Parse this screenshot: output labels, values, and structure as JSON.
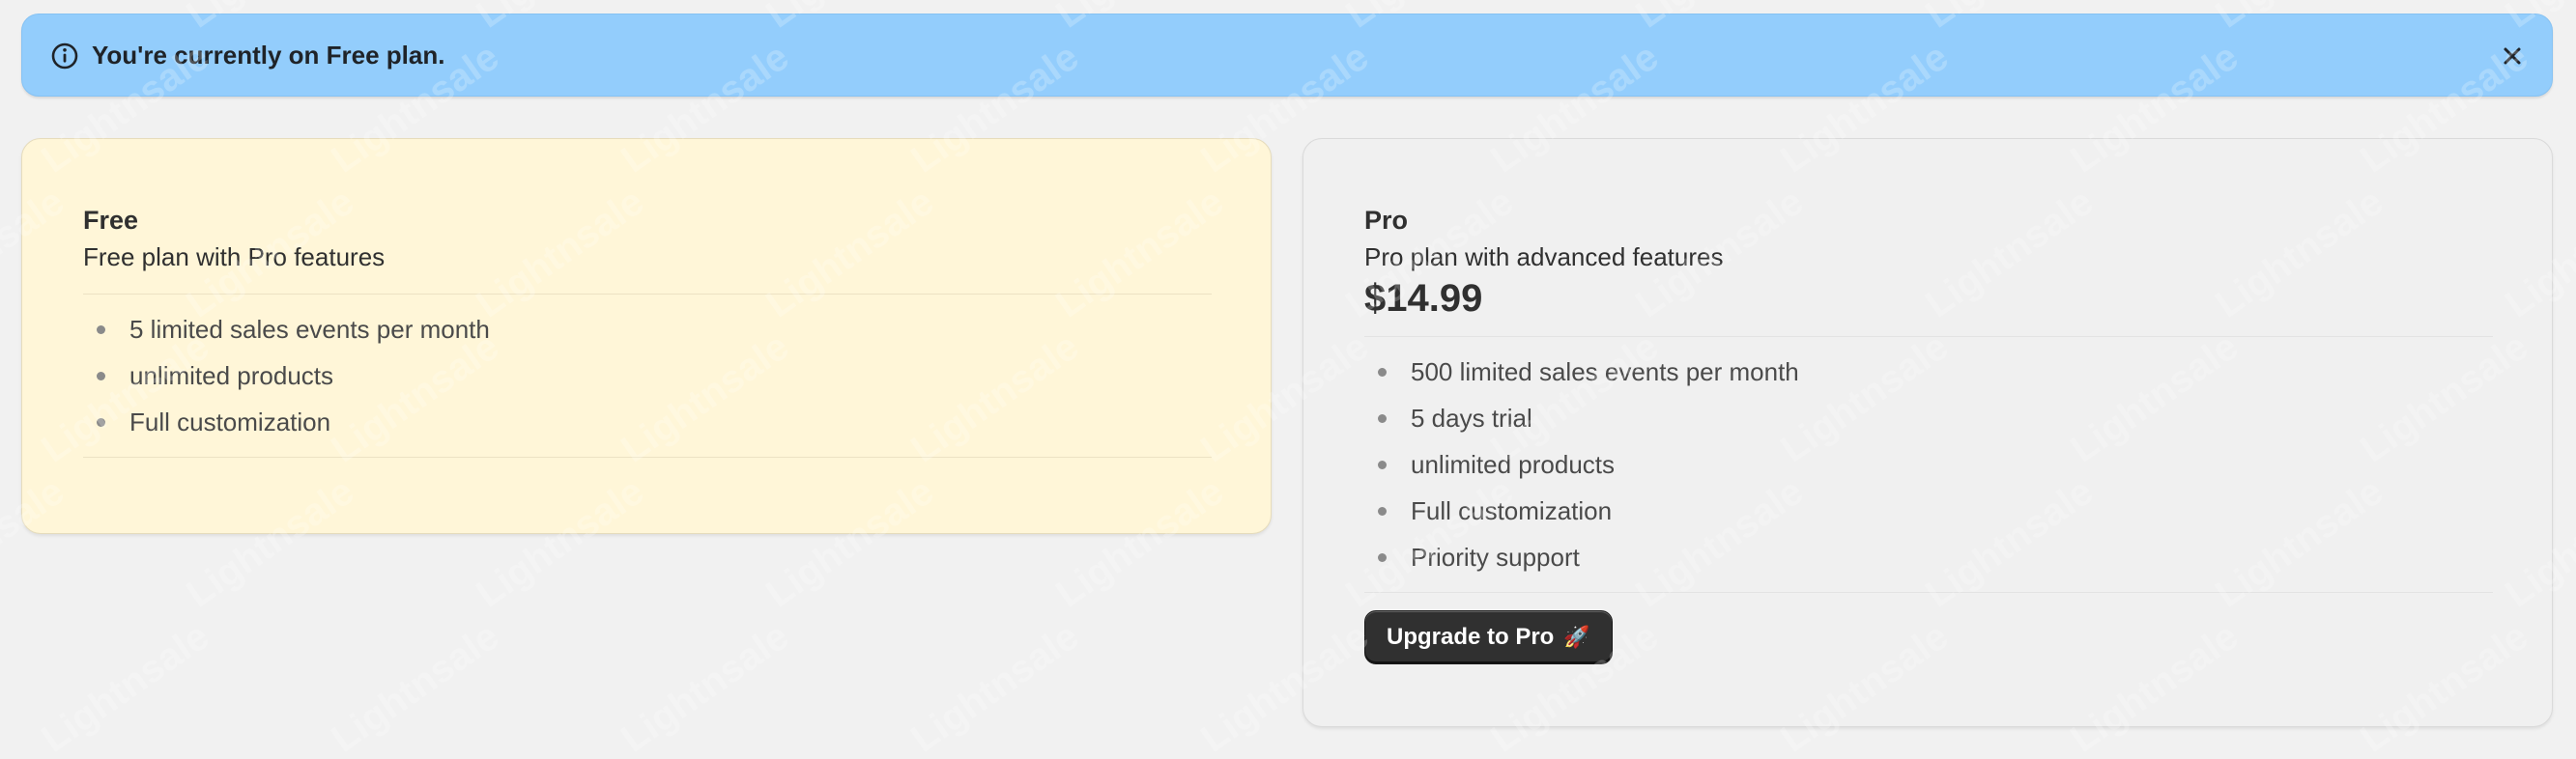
{
  "banner": {
    "message": "You're currently on Free plan.",
    "bg_color": "#93cdfc",
    "info_icon": "info-circle-icon",
    "close_icon": "close-icon"
  },
  "watermark": {
    "text": "Lightnsale"
  },
  "plans": {
    "free": {
      "name": "Free",
      "description": "Free plan with Pro features",
      "bg_color": "#fff6d8",
      "features": [
        "5 limited sales events per month",
        "unlimited products",
        "Full customization"
      ]
    },
    "pro": {
      "name": "Pro",
      "description": "Pro plan with advanced features",
      "price": "$14.99",
      "features": [
        "500 limited sales events per month",
        "5 days trial",
        "unlimited products",
        "Full customization",
        "Priority support"
      ],
      "upgrade_label": "Upgrade to Pro",
      "upgrade_emoji": "🚀"
    }
  }
}
